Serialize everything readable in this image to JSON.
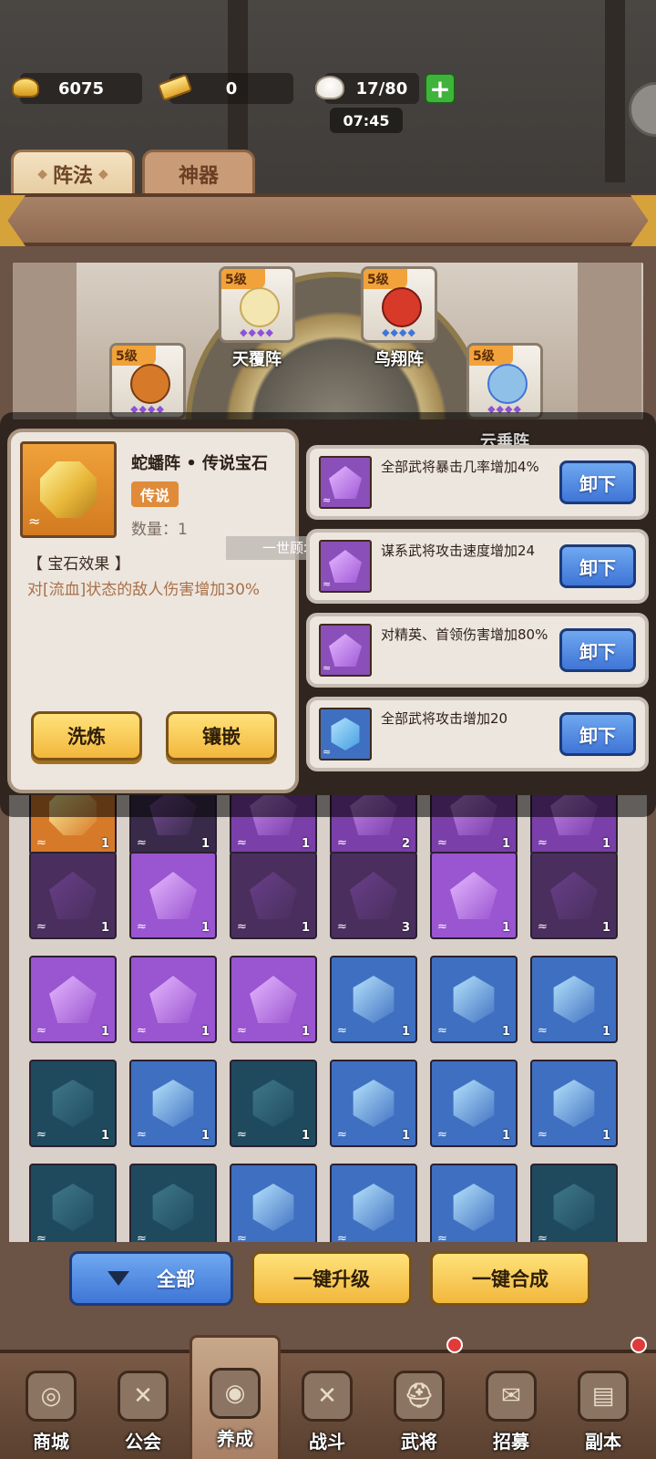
{
  "resources": {
    "gold": "6075",
    "ticket": "0",
    "stamina": "17/80",
    "timer": "07:45"
  },
  "tabs": [
    {
      "label": "阵法",
      "active": true
    },
    {
      "label": "神器",
      "active": false
    }
  ],
  "formations": [
    {
      "level": "5级",
      "name": "天覆阵",
      "emblem_color": "#f3e6b0"
    },
    {
      "level": "5级",
      "name": "鸟翔阵",
      "emblem_color": "#d83a2a"
    },
    {
      "level": "5级",
      "name": "",
      "emblem_color": "#d67a2a"
    },
    {
      "level": "5级",
      "name": "云垂阵",
      "emblem_color": "#8fc0e8"
    }
  ],
  "gem_info": {
    "title": "蛇蟠阵 • 传说宝石",
    "rarity": "传说",
    "quantity": "数量：1",
    "effect_title": "【 宝石效果 】",
    "effect_text": "对[流血]状态的敌人伤害增加30%",
    "refine_label": "洗炼",
    "inlay_label": "镶嵌"
  },
  "system_message": "一世顾北成功加入公会",
  "slots": [
    {
      "text": "全部武将暴击几率增加4%",
      "gem": "purple",
      "action": "卸下"
    },
    {
      "text": "谋系武将攻击速度增加24",
      "gem": "purple",
      "action": "卸下"
    },
    {
      "text": "对精英、首领伤害增加80%",
      "gem": "purple",
      "action": "卸下"
    },
    {
      "text": "全部武将攻击增加20",
      "gem": "blue",
      "action": "卸下"
    }
  ],
  "grid_counts": [
    [
      "1",
      "1",
      "1",
      "2",
      "1",
      "1"
    ],
    [
      "1",
      "1",
      "1",
      "3",
      "1",
      "1"
    ],
    [
      "1",
      "1",
      "1",
      "1",
      "1",
      "1"
    ],
    [
      "1",
      "1",
      "1",
      "1",
      "1",
      "1"
    ]
  ],
  "buttons": {
    "filter": "全部",
    "upgrade_all": "一键升级",
    "merge_all": "一键合成"
  },
  "nav": [
    {
      "label": "商城",
      "icon": "shop-icon",
      "active": false,
      "badge": false
    },
    {
      "label": "公会",
      "icon": "guild-icon",
      "active": false,
      "badge": false
    },
    {
      "label": "养成",
      "icon": "develop-icon",
      "active": true,
      "badge": false
    },
    {
      "label": "战斗",
      "icon": "battle-icon",
      "active": false,
      "badge": false
    },
    {
      "label": "武将",
      "icon": "general-icon",
      "active": false,
      "badge": true
    },
    {
      "label": "招募",
      "icon": "recruit-icon",
      "active": false,
      "badge": false
    },
    {
      "label": "副本",
      "icon": "dungeon-icon",
      "active": false,
      "badge": true
    }
  ],
  "colors": {
    "purple_gem": "#b565e6",
    "dark_purple_gem": "#4a2f5e",
    "blue_gem": "#4aa8ee",
    "dark_blue_gem": "#1f4a5e",
    "legend_orange": "#e08b3a",
    "unload_blue": "#3f75d6"
  }
}
